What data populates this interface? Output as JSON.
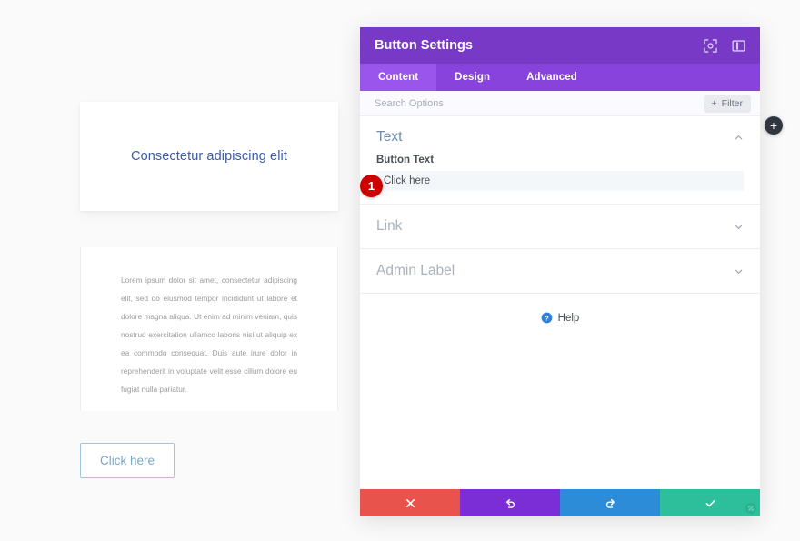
{
  "page_preview": {
    "hero_title": "Consectetur adipiscing elit",
    "body_text": "Lorem ipsum dolor sit amet, consectetur adipiscing elit, sed do eiusmod tempor incididunt ut labore et dolore magna aliqua. Ut enim ad minim veniam, quis nostrud exercitation ullamco laboris nisi ut aliquip ex ea commodo consequat. Duis aute irure dolor in reprehenderit in voluptate velit esse cillum dolore eu fugiat nulla pariatur.",
    "cta_label": "Click here"
  },
  "modal": {
    "title": "Button Settings",
    "header_icons": [
      {
        "name": "focus-icon"
      },
      {
        "name": "panel-layout-icon"
      }
    ],
    "tabs": [
      {
        "label": "Content",
        "active": true
      },
      {
        "label": "Design",
        "active": false
      },
      {
        "label": "Advanced",
        "active": false
      }
    ],
    "search": {
      "placeholder": "Search Options",
      "value": ""
    },
    "filter_label": "Filter",
    "sections": [
      {
        "title": "Text",
        "expanded": true,
        "field_label": "Button Text",
        "field_value": "Click here",
        "badge": "1"
      },
      {
        "title": "Link",
        "expanded": false
      },
      {
        "title": "Admin Label",
        "expanded": false
      }
    ],
    "help_label": "Help",
    "footer_buttons": [
      {
        "name": "cancel-button",
        "icon": "close-icon",
        "color": "#e8544c"
      },
      {
        "name": "undo-button",
        "icon": "undo-icon",
        "color": "#7b2ed6"
      },
      {
        "name": "redo-button",
        "icon": "redo-icon",
        "color": "#2d8cd8"
      },
      {
        "name": "save-button",
        "icon": "check-icon",
        "color": "#2dbf9b"
      }
    ]
  },
  "floating": {
    "add_label": "+"
  },
  "colors": {
    "header_purple": "#7739c6",
    "tabbar_purple": "#8843dd",
    "tab_active_purple": "#9a55ec",
    "badge_red": "#cc0000",
    "link_blue": "#3a5ba8"
  }
}
